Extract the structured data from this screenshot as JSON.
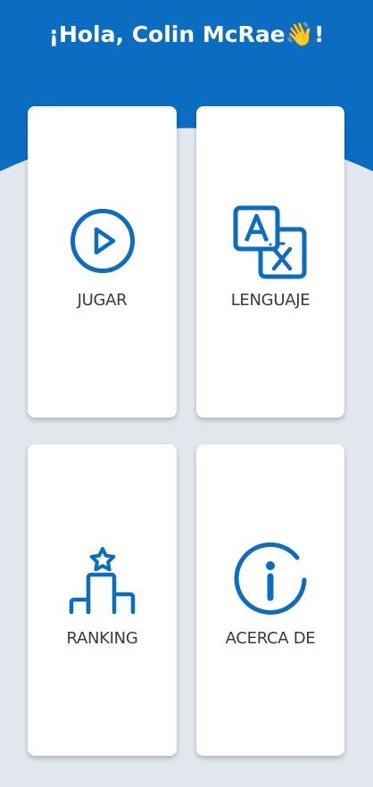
{
  "header": {
    "greeting": "¡Hola, Colin McRae",
    "wave_emoji": "👋",
    "exclaim": "!"
  },
  "menu": {
    "play_label": "JUGAR",
    "language_label": "LENGUAJE",
    "ranking_label": "RANKING",
    "about_label": "ACERCA DE"
  },
  "colors": {
    "brand_blue": "#0a6dc2",
    "background": "#e2e7ee",
    "card": "#ffffff",
    "label_text": "#3a3a3a"
  },
  "icons": {
    "play": "play-circle-icon",
    "language": "translate-icon",
    "ranking": "podium-star-icon",
    "about": "info-circle-icon"
  }
}
